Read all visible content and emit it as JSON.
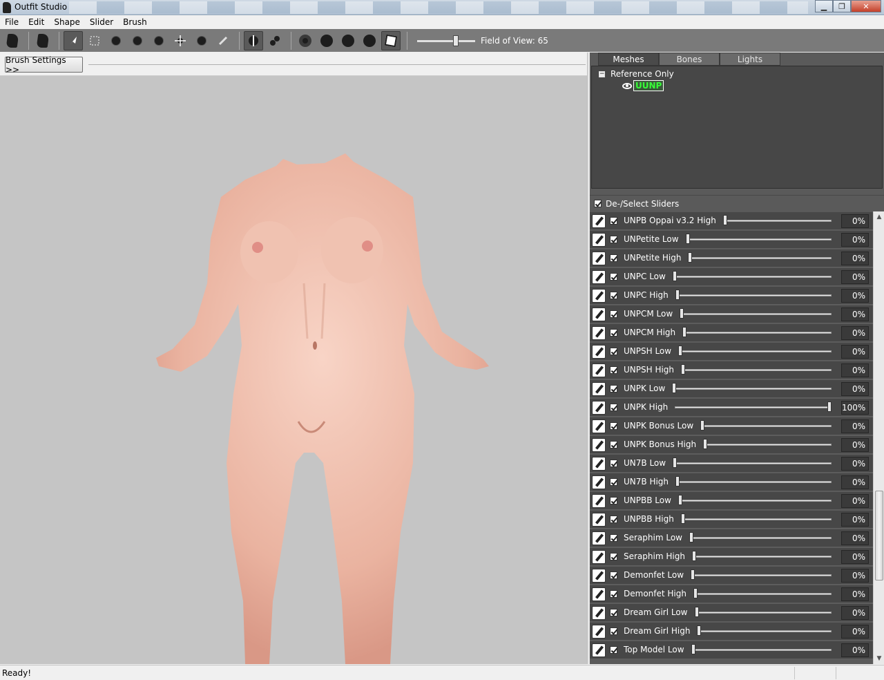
{
  "window": {
    "title": "Outfit Studio"
  },
  "menu": [
    "File",
    "Edit",
    "Shape",
    "Slider",
    "Brush"
  ],
  "toolbar": {
    "fov_label": "Field of View: 65",
    "fov_value": 65
  },
  "brush_settings_label": "Brush Settings >>",
  "tabs": [
    {
      "label": "Meshes",
      "active": true
    },
    {
      "label": "Bones",
      "active": false
    },
    {
      "label": "Lights",
      "active": false
    }
  ],
  "tree": {
    "group": "Reference Only",
    "mesh": "UUNP"
  },
  "select_sliders_label": "De-/Select Sliders",
  "sliders": [
    {
      "name": "UNPB Oppai v3.2 High",
      "value": "0%",
      "level": 0
    },
    {
      "name": "UNPetite Low",
      "value": "0%",
      "level": 0
    },
    {
      "name": "UNPetite High",
      "value": "0%",
      "level": 0
    },
    {
      "name": "UNPC Low",
      "value": "0%",
      "level": 0
    },
    {
      "name": "UNPC High",
      "value": "0%",
      "level": 0
    },
    {
      "name": "UNPCM Low",
      "value": "0%",
      "level": 0
    },
    {
      "name": "UNPCM High",
      "value": "0%",
      "level": 0
    },
    {
      "name": "UNPSH Low",
      "value": "0%",
      "level": 0
    },
    {
      "name": "UNPSH High",
      "value": "0%",
      "level": 0
    },
    {
      "name": "UNPK Low",
      "value": "0%",
      "level": 0
    },
    {
      "name": "UNPK High",
      "value": "100%",
      "level": 100
    },
    {
      "name": "UNPK Bonus Low",
      "value": "0%",
      "level": 0
    },
    {
      "name": "UNPK Bonus High",
      "value": "0%",
      "level": 0
    },
    {
      "name": "UN7B Low",
      "value": "0%",
      "level": 0
    },
    {
      "name": "UN7B High",
      "value": "0%",
      "level": 0
    },
    {
      "name": "UNPBB Low",
      "value": "0%",
      "level": 0
    },
    {
      "name": "UNPBB High",
      "value": "0%",
      "level": 0
    },
    {
      "name": "Seraphim Low",
      "value": "0%",
      "level": 0
    },
    {
      "name": "Seraphim High",
      "value": "0%",
      "level": 0
    },
    {
      "name": "Demonfet Low",
      "value": "0%",
      "level": 0
    },
    {
      "name": "Demonfet High",
      "value": "0%",
      "level": 0
    },
    {
      "name": "Dream Girl Low",
      "value": "0%",
      "level": 0
    },
    {
      "name": "Dream Girl High",
      "value": "0%",
      "level": 0
    },
    {
      "name": "Top Model Low",
      "value": "0%",
      "level": 0
    }
  ],
  "status": "Ready!",
  "colors": {
    "panel": "#474747",
    "viewport": "#c5c5c5",
    "mesh_highlight": "#37ff37"
  }
}
